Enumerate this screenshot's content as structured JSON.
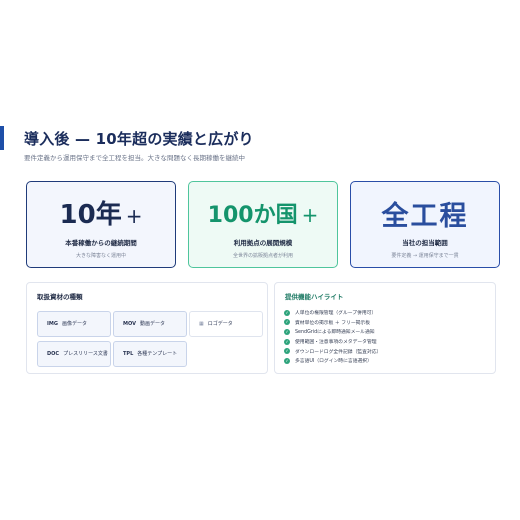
{
  "header": {
    "title": "導入後 — 10年超の実績と広がり",
    "subtitle": "要件定義から運用保守まで全工程を担当。大きな問題なく長期稼働を継続中"
  },
  "stats": [
    {
      "value": "10年",
      "suffix": "+",
      "label": "本番稼働からの継続期間",
      "note": "大きな障害なく運用中"
    },
    {
      "value": "100か国",
      "suffix": "+",
      "label": "利用拠点の展開規模",
      "note": "全世界の拡販拠点者が利用"
    },
    {
      "value": "全工程",
      "suffix": "",
      "label": "当社の担当範囲",
      "note": "要件定義 → 運用保守まで一貫"
    }
  ],
  "materials": {
    "heading": "取扱資材の種類",
    "items": [
      {
        "code": "IMG",
        "label": "画像データ"
      },
      {
        "code": "MOV",
        "label": "動画データ"
      },
      {
        "code": "",
        "icon": "document-icon",
        "label": "ロゴデータ"
      },
      {
        "code": "DOC",
        "label": "プレスリリース文書"
      },
      {
        "code": "TPL",
        "label": "各種テンプレート"
      }
    ]
  },
  "highlights": {
    "heading": "提供機能ハイライト",
    "items": [
      "人単位の権限管理（グループ併用可）",
      "資材単位の掲示板 ＋ フリー掲示板",
      "SendGridによる即時通知メール通知",
      "使用範囲・注意事項のメタデータ管理",
      "ダウンロードログ全件記録（監査対応）",
      "多言語UI（ログイン時に言語選択）"
    ]
  },
  "colors": {
    "accent": "#1e4fa8",
    "stat1": "#1b2b52",
    "stat2": "#14946c",
    "stat3": "#2a4e9e",
    "check": "#2ea47c"
  }
}
